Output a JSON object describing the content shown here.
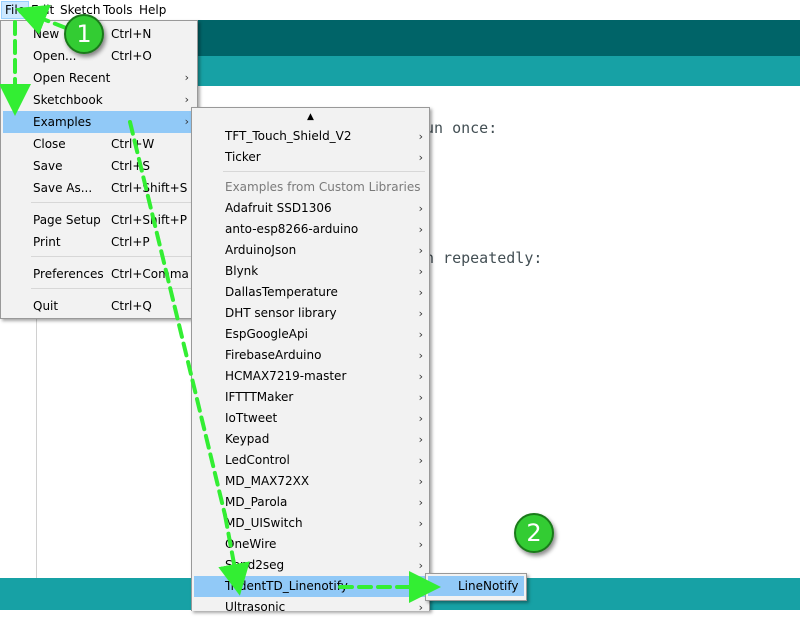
{
  "menubar": {
    "items": [
      "File",
      "Edit",
      "Sketch",
      "Tools",
      "Help"
    ]
  },
  "editor": {
    "code_line_1": "un once:",
    "code_line_2": "n repeatedly:"
  },
  "file_menu": {
    "items": [
      {
        "label": "New",
        "shortcut": "Ctrl+N"
      },
      {
        "label": "Open...",
        "shortcut": "Ctrl+O"
      },
      {
        "label": "Open Recent",
        "shortcut": "",
        "arrow": "›"
      },
      {
        "label": "Sketchbook",
        "shortcut": "",
        "arrow": "›"
      },
      {
        "label": "Examples",
        "shortcut": "",
        "arrow": "›"
      },
      {
        "label": "Close",
        "shortcut": "Ctrl+W"
      },
      {
        "label": "Save",
        "shortcut": "Ctrl+S"
      },
      {
        "label": "Save As...",
        "shortcut": "Ctrl+Shift+S"
      },
      {
        "label": "Page Setup",
        "shortcut": "Ctrl+Shift+P"
      },
      {
        "label": "Print",
        "shortcut": "Ctrl+P"
      },
      {
        "label": "Preferences",
        "shortcut": "Ctrl+Comma"
      },
      {
        "label": "Quit",
        "shortcut": "Ctrl+Q"
      }
    ]
  },
  "examples_menu": {
    "scroll_up": "▲",
    "items": [
      "TFT_Touch_Shield_V2",
      "Ticker",
      "Examples from Custom Libraries",
      "Adafruit SSD1306",
      "anto-esp8266-arduino",
      "ArduinoJson",
      "Blynk",
      "DallasTemperature",
      "DHT sensor library",
      "EspGoogleApi",
      "FirebaseArduino",
      "HCMAX7219-master",
      "IFTTTMaker",
      "IoTtweet",
      "Keypad",
      "LedControl",
      "MD_MAX72XX",
      "MD_Parola",
      "MD_UISwitch",
      "OneWire",
      "Send2seg",
      "TridentTD_Linenotify",
      "Ultrasonic"
    ]
  },
  "linenotify_menu": {
    "items": [
      "LineNotify"
    ]
  },
  "annotations": {
    "step1": "1",
    "step2": "2",
    "color": "#33ee33"
  }
}
